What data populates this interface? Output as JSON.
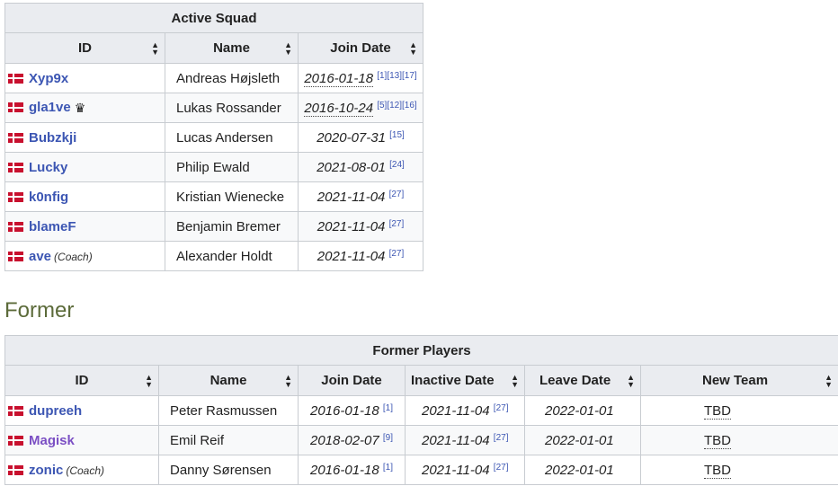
{
  "active_squad": {
    "caption": "Active Squad",
    "headers": [
      "ID",
      "Name",
      "Join Date"
    ],
    "rows": [
      {
        "id": "Xyp9x",
        "role": "",
        "name": "Andreas Højsleth",
        "join_date": "2016-01-18",
        "join_refs": "[1][13][17]",
        "captain": false
      },
      {
        "id": "gla1ve",
        "role": "",
        "name": "Lukas Rossander",
        "join_date": "2016-10-24",
        "join_refs": "[5][12][16]",
        "captain": true
      },
      {
        "id": "Bubzkji",
        "role": "",
        "name": "Lucas Andersen",
        "join_date": "2020-07-31",
        "join_refs": "[15]",
        "captain": false
      },
      {
        "id": "Lucky",
        "role": "",
        "name": "Philip Ewald",
        "join_date": "2021-08-01",
        "join_refs": "[24]",
        "captain": false
      },
      {
        "id": "k0nfig",
        "role": "",
        "name": "Kristian Wienecke",
        "join_date": "2021-11-04",
        "join_refs": "[27]",
        "captain": false
      },
      {
        "id": "blameF",
        "role": "",
        "name": "Benjamin Bremer",
        "join_date": "2021-11-04",
        "join_refs": "[27]",
        "captain": false
      },
      {
        "id": "ave",
        "role": "(Coach)",
        "name": "Alexander Holdt",
        "join_date": "2021-11-04",
        "join_refs": "[27]",
        "captain": false
      }
    ]
  },
  "former_section_title": "Former",
  "former_players": {
    "caption": "Former Players",
    "headers": [
      "ID",
      "Name",
      "Join Date",
      "Inactive Date",
      "Leave Date",
      "New Team"
    ],
    "rows": [
      {
        "id": "dupreeh",
        "role": "",
        "name": "Peter Rasmussen",
        "join_date": "2016-01-18",
        "join_refs": "[1]",
        "inactive_date": "2021-11-04",
        "inactive_refs": "[27]",
        "leave_date": "2022-01-01",
        "new_team": "TBD"
      },
      {
        "id": "Magisk",
        "role": "",
        "name": "Emil Reif",
        "join_date": "2018-02-07",
        "join_refs": "[9]",
        "inactive_date": "2021-11-04",
        "inactive_refs": "[27]",
        "leave_date": "2022-01-01",
        "new_team": "TBD"
      },
      {
        "id": "zonic",
        "role": "(Coach)",
        "name": "Danny Sørensen",
        "join_date": "2016-01-18",
        "join_refs": "[1]",
        "inactive_date": "2021-11-04",
        "inactive_refs": "[27]",
        "leave_date": "2022-01-01",
        "new_team": "TBD"
      }
    ]
  },
  "icons": {
    "flag": "denmark-flag-icon",
    "sort": "sort-arrows-icon",
    "captain": "crown-icon"
  },
  "colors": {
    "link": "#3c56b3",
    "visited_link": "#7b4fc4",
    "section_title": "#5c6b3a",
    "header_bg": "#eaecf0",
    "flag_red": "#c8102e"
  }
}
